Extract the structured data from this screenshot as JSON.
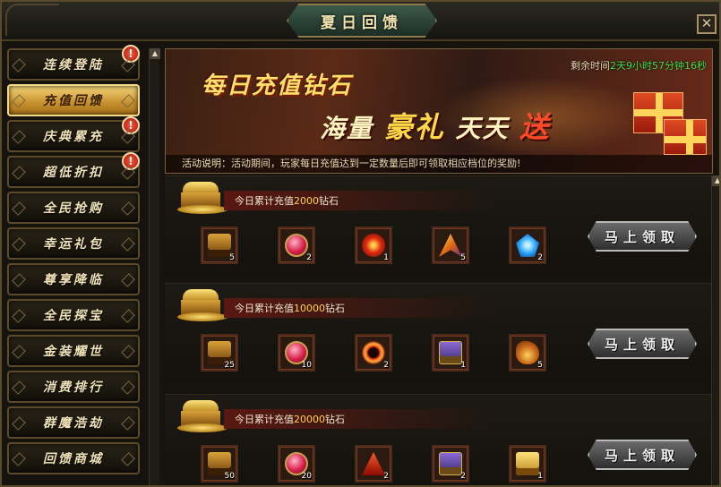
{
  "window": {
    "title": "夏日回馈",
    "close_label": "✕"
  },
  "sidebar": {
    "items": [
      {
        "label": "连续登陆",
        "badge": "!",
        "active": false
      },
      {
        "label": "充值回馈",
        "badge": "",
        "active": true
      },
      {
        "label": "庆典累充",
        "badge": "!",
        "active": false
      },
      {
        "label": "超低折扣",
        "badge": "!",
        "active": false
      },
      {
        "label": "全民抢购",
        "badge": "",
        "active": false
      },
      {
        "label": "幸运礼包",
        "badge": "",
        "active": false
      },
      {
        "label": "尊享降临",
        "badge": "",
        "active": false
      },
      {
        "label": "全民探宝",
        "badge": "",
        "active": false
      },
      {
        "label": "金装耀世",
        "badge": "",
        "active": false
      },
      {
        "label": "消费排行",
        "badge": "",
        "active": false
      },
      {
        "label": "群魔浩劫",
        "badge": "",
        "active": false
      },
      {
        "label": "回馈商城",
        "badge": "",
        "active": false
      }
    ]
  },
  "banner": {
    "headline1": "每日充值钻石",
    "headline2_a": "海量",
    "headline2_b": "豪礼",
    "headline2_c": "天天",
    "headline2_d": "送",
    "countdown_label": "剩余时间",
    "countdown_value": "2天9小时57分钟16秒",
    "description_label": "活动说明：",
    "description_text": "活动期间，玩家每日充值达到一定数量后即可领取相应档位的奖励!"
  },
  "tiers": [
    {
      "prefix": "今日累计充值",
      "amount": "2000",
      "suffix": "钻石",
      "claim_label": "马上领取",
      "items": [
        {
          "icon": "treasure-chest-icon",
          "count": "5"
        },
        {
          "icon": "pink-gem-icon",
          "count": "2"
        },
        {
          "icon": "red-orb-icon",
          "count": "1"
        },
        {
          "icon": "wing-icon",
          "count": "5"
        },
        {
          "icon": "blue-crystal-icon",
          "count": "2"
        }
      ]
    },
    {
      "prefix": "今日累计充值",
      "amount": "10000",
      "suffix": "钻石",
      "claim_label": "马上领取",
      "items": [
        {
          "icon": "treasure-chest-icon",
          "count": "25"
        },
        {
          "icon": "pink-gem-icon",
          "count": "10"
        },
        {
          "icon": "red-ring-icon",
          "count": "2"
        },
        {
          "icon": "purple-chest-icon",
          "count": "1"
        },
        {
          "icon": "golden-dragon-icon",
          "count": "5"
        }
      ]
    },
    {
      "prefix": "今日累计充值",
      "amount": "20000",
      "suffix": "钻石",
      "claim_label": "马上领取",
      "items": [
        {
          "icon": "treasure-chest-icon",
          "count": "50"
        },
        {
          "icon": "pink-gem-icon",
          "count": "20"
        },
        {
          "icon": "red-triangle-icon",
          "count": "2"
        },
        {
          "icon": "purple-chest-icon",
          "count": "2"
        },
        {
          "icon": "gold-chest-icon",
          "count": "1"
        }
      ]
    }
  ],
  "colors": {
    "accent_gold": "#ffd24a",
    "countdown_green": "#36e04a",
    "active_tab": "#c58f2c"
  }
}
